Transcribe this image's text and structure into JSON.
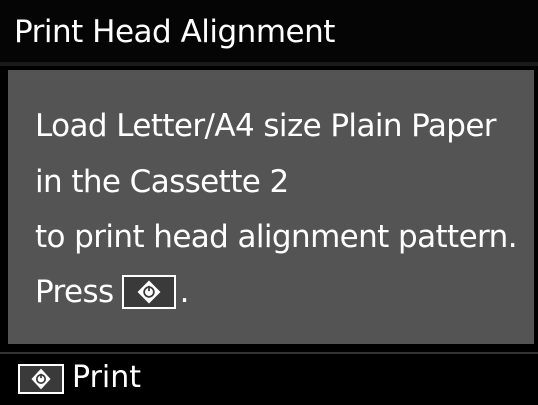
{
  "screen": {
    "title": "Print Head Alignment",
    "message": {
      "line1": "Load Letter/A4 size Plain Paper",
      "line2": "in the Cassette 2",
      "line3": "to print head alignment pattern.",
      "line4_prefix": "Press",
      "line4_suffix": "."
    },
    "footer": {
      "action_label": "Print"
    }
  },
  "icons": {
    "start_button": "start-diamond-icon"
  },
  "colors": {
    "background": "#000000",
    "panel": "#545454",
    "text": "#ffffff"
  }
}
